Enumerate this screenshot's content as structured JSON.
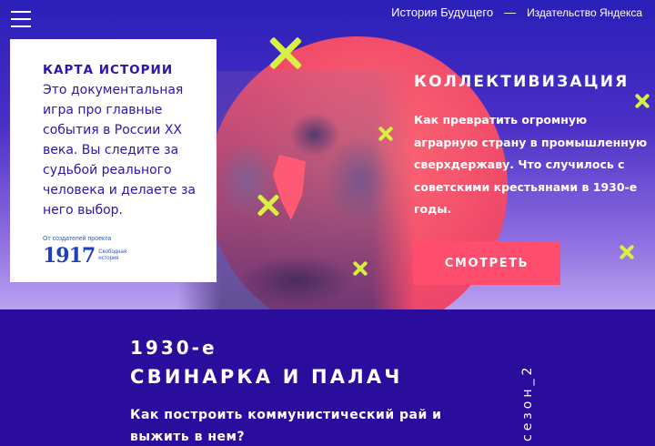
{
  "header": {
    "site_title": "История Будущего",
    "separator": "—",
    "publisher": "Издательство Яндекса"
  },
  "icons": {
    "menu": "hamburger-icon",
    "decor": "x-mark-icon"
  },
  "colors": {
    "background": "#2a0d9c",
    "accent": "#ff4d6d",
    "decor": "#d8f041",
    "card_text": "#2a17a8"
  },
  "card": {
    "title": "КАРТА ИСТОРИИ",
    "text": "Это документальная игра про главные события в России XX века. Вы следите за судьбой реального человека и делаете за него выбор.",
    "project_caption": "От создателей проекта",
    "project_name": "1917",
    "project_subtitle": "Свободная история"
  },
  "episode": {
    "title": "КОЛЛЕКТИВИЗАЦИЯ",
    "description": "Как превратить огромную аграрную страну в промышленную сверхдержаву. Что случилось с советскими крестьянами в 1930-е годы.",
    "button_label": "СМОТРЕТЬ"
  },
  "season": {
    "year": "1930-е",
    "title": "СВИНАРКА И ПАЛАЧ",
    "question": "Как построить коммунистический рай и выжить в нем?",
    "label": "сезон_2"
  }
}
